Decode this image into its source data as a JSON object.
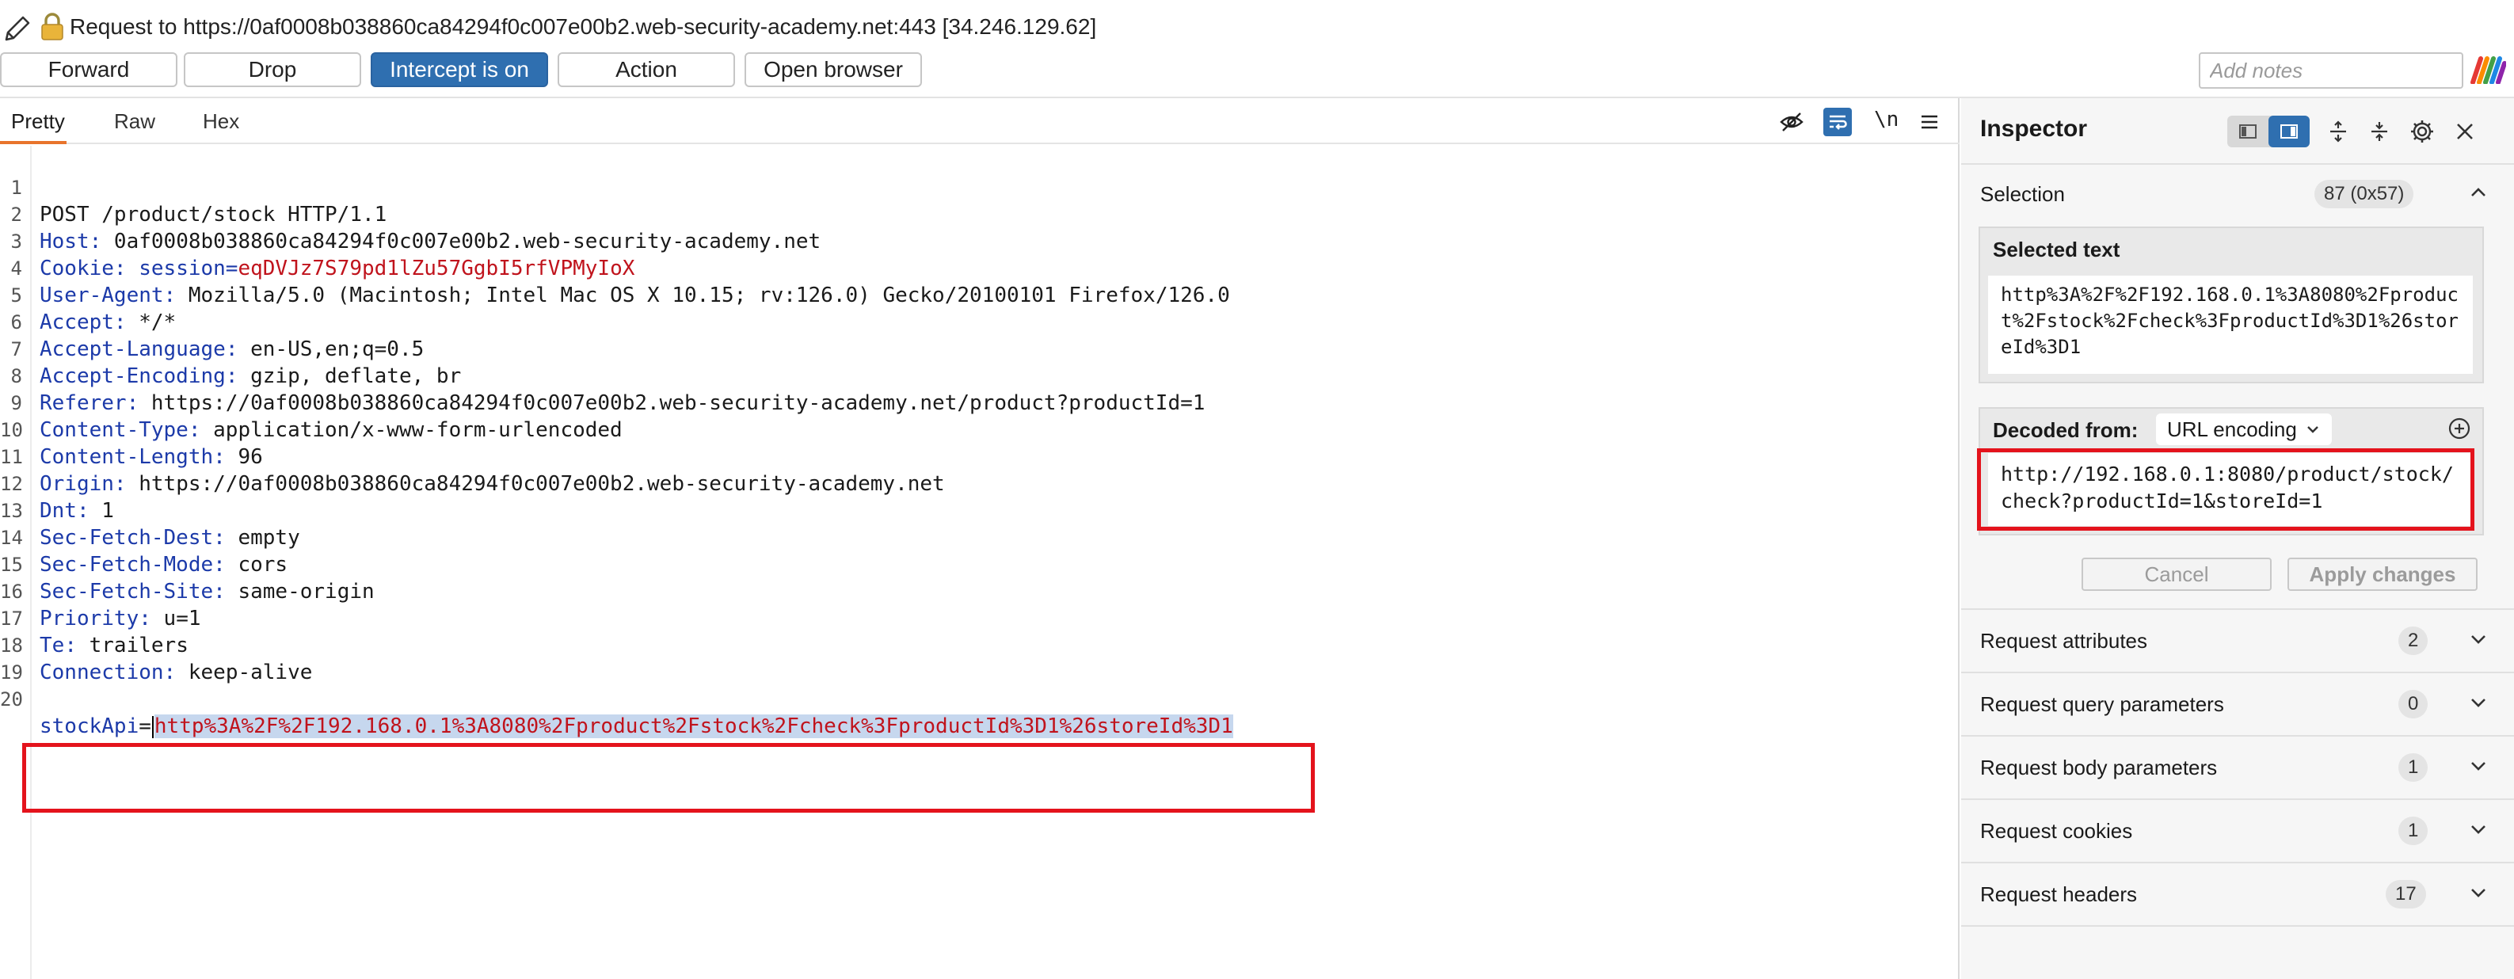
{
  "header": {
    "request_title": "Request to https://0af0008b038860ca84294f0c007e00b2.web-security-academy.net:443  [34.246.129.62]",
    "buttons": {
      "forward": "Forward",
      "drop": "Drop",
      "intercept": "Intercept is on",
      "action": "Action",
      "open_browser": "Open browser"
    },
    "notes_placeholder": "Add notes"
  },
  "editor": {
    "tabs": [
      "Pretty",
      "Raw",
      "Hex"
    ],
    "active_tab": "Pretty",
    "newline_toggle": "\\n",
    "request_line": "POST /product/stock HTTP/1.1",
    "headers": [
      {
        "n": "2",
        "key": "Host",
        "value": " 0af0008b038860ca84294f0c007e00b2.web-security-academy.net"
      },
      {
        "n": "3",
        "key": "Cookie",
        "value": " session=eqDVJz7S79pd1lZu57GgbI5rfVPMyIoX"
      },
      {
        "n": "4",
        "key": "User-Agent",
        "value": " Mozilla/5.0 (Macintosh; Intel Mac OS X 10.15; rv:126.0) Gecko/20100101 Firefox/126.0"
      },
      {
        "n": "5",
        "key": "Accept",
        "value": " */*"
      },
      {
        "n": "6",
        "key": "Accept-Language",
        "value": " en-US,en;q=0.5"
      },
      {
        "n": "7",
        "key": "Accept-Encoding",
        "value": " gzip, deflate, br"
      },
      {
        "n": "8",
        "key": "Referer",
        "value": " https://0af0008b038860ca84294f0c007e00b2.web-security-academy.net/product?productId=1"
      },
      {
        "n": "9",
        "key": "Content-Type",
        "value": " application/x-www-form-urlencoded"
      },
      {
        "n": "10",
        "key": "Content-Length",
        "value": " 96"
      },
      {
        "n": "11",
        "key": "Origin",
        "value": " https://0af0008b038860ca84294f0c007e00b2.web-security-academy.net"
      },
      {
        "n": "12",
        "key": "Dnt",
        "value": " 1"
      },
      {
        "n": "13",
        "key": "Sec-Fetch-Dest",
        "value": " empty"
      },
      {
        "n": "14",
        "key": "Sec-Fetch-Mode",
        "value": " cors"
      },
      {
        "n": "15",
        "key": "Sec-Fetch-Site",
        "value": " same-origin"
      },
      {
        "n": "16",
        "key": "Priority",
        "value": " u=1"
      },
      {
        "n": "17",
        "key": "Te",
        "value": " trailers"
      },
      {
        "n": "18",
        "key": "Connection",
        "value": " keep-alive"
      }
    ],
    "cookie_prefix": " session=",
    "cookie_value": "eqDVJz7S79pd1lZu57GgbI5rfVPMyIoX",
    "line_numbers": {
      "first": "1",
      "blank": "19",
      "body": "20"
    },
    "body_param_key": "stockApi",
    "body_param_eq": "=",
    "body_param_value": "http%3A%2F%2F192.168.0.1%3A8080%2Fproduct%2Fstock%2Fcheck%3FproductId%3D1%26storeId%3D1"
  },
  "inspector": {
    "title": "Inspector",
    "selection_label": "Selection",
    "selection_badge": "87 (0x57)",
    "selected_text_title": "Selected text",
    "selected_text": "http%3A%2F%2F192.168.0.1%3A8080%2Fproduct%2Fstock%2Fcheck%3FproductId%3D1%26storeId%3D1",
    "decoded_from_label": "Decoded from:",
    "decoding": "URL encoding",
    "decoded_text": "http://192.168.0.1:8080/product/stock/check?productId=1&storeId=1",
    "cancel": "Cancel",
    "apply": "Apply changes",
    "sections": [
      {
        "label": "Request attributes",
        "count": "2"
      },
      {
        "label": "Request query parameters",
        "count": "0"
      },
      {
        "label": "Request body parameters",
        "count": "1"
      },
      {
        "label": "Request cookies",
        "count": "1"
      },
      {
        "label": "Request headers",
        "count": "17"
      }
    ]
  },
  "colors": {
    "accent_blue": "#2f6fb0",
    "header_key": "#1c3aa9",
    "value_red": "#c0131c",
    "highlight_box": "#e4131c",
    "tab_underline": "#e8742c"
  }
}
